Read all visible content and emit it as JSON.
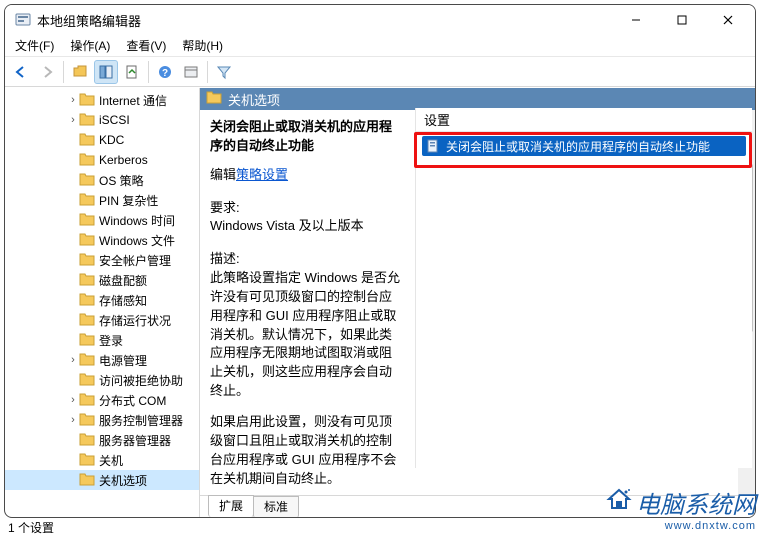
{
  "window": {
    "title": "本地组策略编辑器"
  },
  "menu": {
    "file": "文件(F)",
    "action": "操作(A)",
    "view": "查看(V)",
    "help": "帮助(H)"
  },
  "tree": {
    "items": [
      {
        "label": "Internet 通信",
        "expandable": true
      },
      {
        "label": "iSCSI",
        "expandable": true
      },
      {
        "label": "KDC"
      },
      {
        "label": "Kerberos"
      },
      {
        "label": "OS 策略"
      },
      {
        "label": "PIN 复杂性"
      },
      {
        "label": "Windows 时间"
      },
      {
        "label": "Windows 文件"
      },
      {
        "label": "安全帐户管理"
      },
      {
        "label": "磁盘配额"
      },
      {
        "label": "存储感知"
      },
      {
        "label": "存储运行状况"
      },
      {
        "label": "登录"
      },
      {
        "label": "电源管理",
        "expandable": true
      },
      {
        "label": "访问被拒绝协助"
      },
      {
        "label": "分布式 COM",
        "expandable": true
      },
      {
        "label": "服务控制管理器",
        "expandable": true
      },
      {
        "label": "服务器管理器"
      },
      {
        "label": "关机"
      },
      {
        "label": "关机选项",
        "selected": true
      }
    ]
  },
  "content": {
    "header": "关机选项",
    "policy_title": "关闭会阻止或取消关机的应用程序的自动终止功能",
    "edit_prefix": "编辑",
    "edit_link": "策略设置",
    "req_label": "要求:",
    "req_text": "Windows Vista 及以上版本",
    "desc_label": "描述:",
    "desc_text": "此策略设置指定 Windows 是否允许没有可见顶级窗口的控制台应用程序和 GUI 应用程序阻止或取消关机。默认情况下，如果此类应用程序无限期地试图取消或阻止关机，则这些应用程序会自动终止。",
    "desc_text2": "如果启用此设置，则没有可见顶级窗口且阻止或取消关机的控制台应用程序或 GUI 应用程序不会在关机期间自动终止。"
  },
  "tabs": {
    "extended": "扩展",
    "standard": "标准"
  },
  "settings": {
    "header": "设置",
    "items": [
      {
        "label": "关闭会阻止或取消关机的应用程序的自动终止功能",
        "selected": true
      }
    ]
  },
  "status": {
    "text": "1 个设置"
  },
  "watermark": {
    "line1": "电脑系统网",
    "line2": "www.dnxtw.com"
  }
}
